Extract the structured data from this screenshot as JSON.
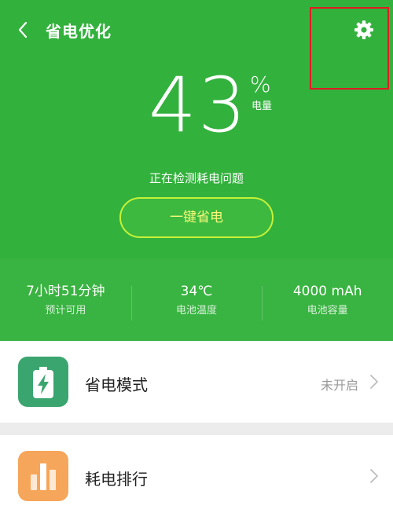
{
  "header": {
    "title": "省电优化",
    "back_icon": "chevron-left-icon",
    "settings_icon": "gear-icon",
    "background_color": "#33b13d",
    "highlight_color": "#e01b22"
  },
  "battery": {
    "percent": "43",
    "percent_sign": "%",
    "unit_label": "电量",
    "status": "正在检测耗电问题",
    "button_label": "一键省电"
  },
  "stats": [
    {
      "value": "7小时51分钟",
      "label": "预计可用"
    },
    {
      "value": "34℃",
      "label": "电池温度"
    },
    {
      "value": "4000 mAh",
      "label": "电池容量"
    }
  ],
  "list": [
    {
      "label": "省电模式",
      "status": "未开启",
      "icon": "battery-charging-icon",
      "icon_color": "#3aa56f"
    },
    {
      "label": "耗电排行",
      "status": "",
      "icon": "bar-chart-icon",
      "icon_color": "#f6a65a"
    }
  ]
}
